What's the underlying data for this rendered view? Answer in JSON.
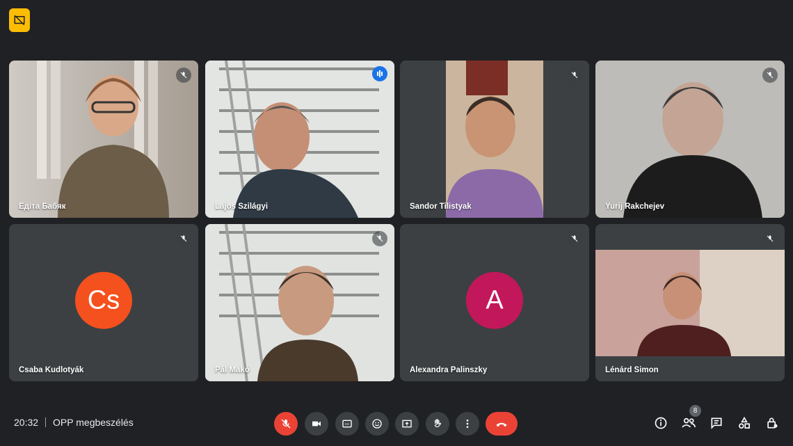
{
  "participants": [
    {
      "name": "Едіта Бабяк"
    },
    {
      "name": "Lajos Szilágyi"
    },
    {
      "name": "Sandor Tilistyak"
    },
    {
      "name": "Yurij Rakchejev"
    },
    {
      "name": "Csaba Kudlotyák",
      "initials": "Cs"
    },
    {
      "name": "Pál Makó"
    },
    {
      "name": "Alexandra Palinszky",
      "initials": "A"
    },
    {
      "name": "Lénárd Simon"
    }
  ],
  "meeting": {
    "time": "20:32",
    "title": "OPP megbeszélés"
  },
  "people_count": "8",
  "colors": {
    "accent": "#8ab4f8",
    "danger": "#ea4335",
    "avatar_orange": "#f4511e",
    "avatar_pink": "#c2185b"
  }
}
